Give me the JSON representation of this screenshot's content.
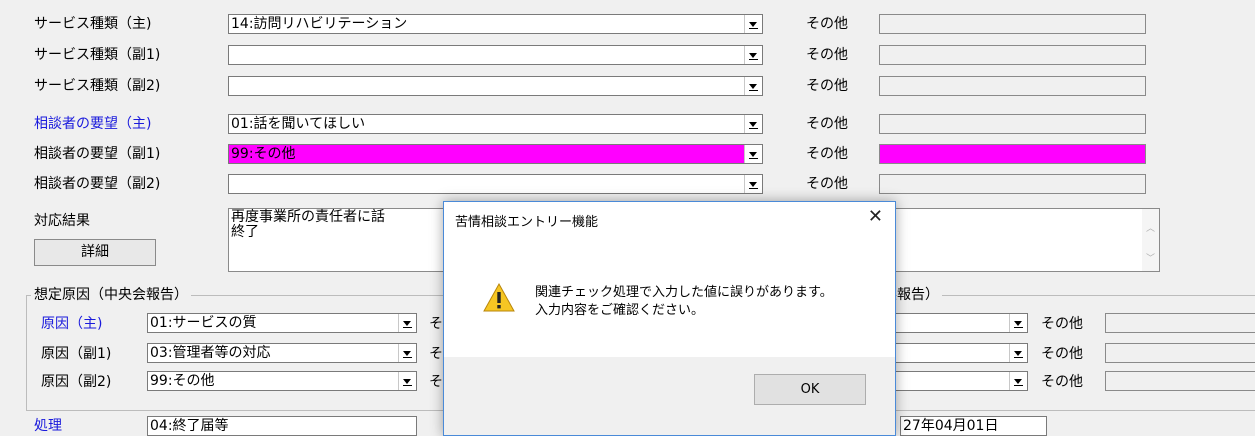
{
  "service": {
    "main": {
      "label": "サービス種類（主)",
      "value": "14:訪問リハビリテーション"
    },
    "sub1": {
      "label": "サービス種類（副1)",
      "value": ""
    },
    "sub2": {
      "label": "サービス種類（副2)",
      "value": ""
    },
    "other_label": "その他"
  },
  "request": {
    "main": {
      "label": "相談者の要望（主)",
      "value": "01:話を聞いてほしい"
    },
    "sub1": {
      "label": "相談者の要望（副1)",
      "value": "99:その他"
    },
    "sub2": {
      "label": "相談者の要望（副2)",
      "value": ""
    },
    "other_label": "その他"
  },
  "result": {
    "label": "対応結果",
    "detail_button": "詳細",
    "text_line1": "再度事業所の責任者に話",
    "text_line2": "終了"
  },
  "cause_central": {
    "group_title": "想定原因（中央会報告）",
    "main": {
      "label": "原因（主)",
      "value": "01:サービスの質"
    },
    "sub1": {
      "label": "原因（副1)",
      "value": "03:管理者等の対応"
    },
    "sub2": {
      "label": "原因（副2)",
      "value": "99:その他"
    }
  },
  "cause_pref": {
    "group_title_fragment": "県報告）",
    "other_label": "その他"
  },
  "bottom_row": {
    "label_fragment": "処理",
    "value_fragment": "04:終了届等",
    "date_fragment": "27年04月01日"
  },
  "dialog": {
    "title": "苦情相談エントリー機能",
    "close": "✕",
    "message_line1": "関連チェック処理で入力した値に誤りがあります。",
    "message_line2": "入力内容をご確認ください。",
    "ok": "OK"
  },
  "colors": {
    "highlight": "#ff00ff",
    "blue_label": "#1a1adc"
  }
}
